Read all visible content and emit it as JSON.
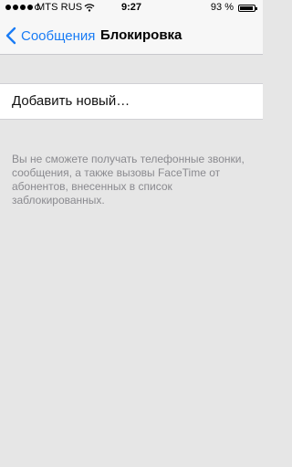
{
  "status_bar": {
    "carrier": "MTS RUS",
    "time": "9:27",
    "battery_percent": "93 %",
    "battery_level": 0.93,
    "signal_bars_filled": 4,
    "signal_bars_total": 5
  },
  "nav": {
    "back_label": "Сообщения",
    "title": "Блокировка",
    "accent_color": "#1a7cf5"
  },
  "list": {
    "add_new_label": "Добавить новый…"
  },
  "footer": {
    "note": "Вы не сможете получать телефонные звонки, сообщения, а также вызовы FaceTime от абонентов, внесенных в список заблокированных."
  },
  "icons": [
    "signal-icon",
    "wifi-icon",
    "battery-icon",
    "chevron-left-icon"
  ]
}
